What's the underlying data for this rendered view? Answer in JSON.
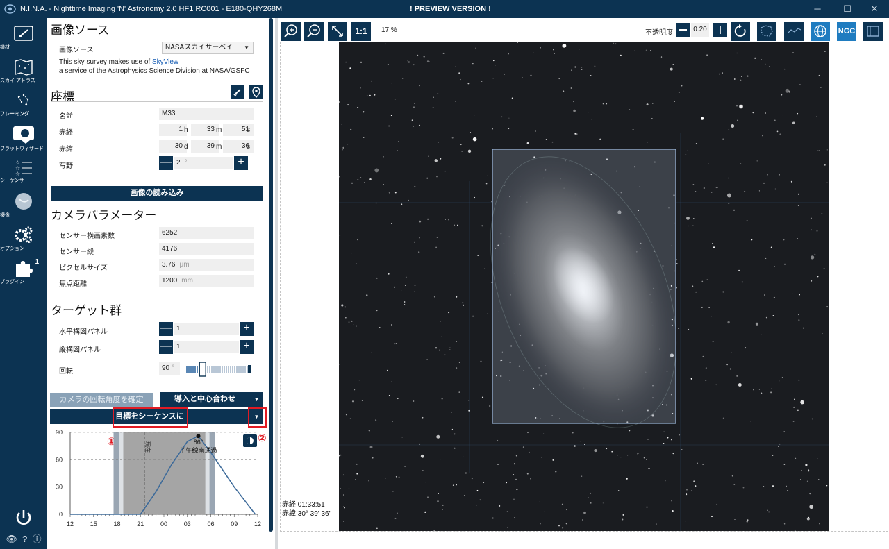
{
  "titlebar": {
    "title": "N.I.N.A. - Nighttime Imaging 'N' Astronomy 2.0 HF1 RC001  -  E180-QHY268M",
    "preview": "! PREVIEW VERSION !",
    "minimize": "─",
    "maximize": "☐",
    "close": "✕"
  },
  "nav": {
    "equipment": "機材",
    "skyatlas": "スカイ アトラス",
    "framing": "フレーミング",
    "flat": "フラットウィザード",
    "sequencer": "シーケンサー",
    "imaging": "撮像",
    "options": "オプション",
    "plugins": "プラグイン",
    "plugins_badge": "1"
  },
  "image_source": {
    "title": "画像ソース",
    "label": "画像ソース",
    "selected": "NASAスカイサーベイ",
    "note1": "This sky survey makes use of",
    "note_link": "SkyView",
    "note2": " a service of the Astrophysics Science Division at NASA/GSFC"
  },
  "coordinates": {
    "title": "座標",
    "name_label": "名前",
    "name_value": "M33",
    "ra_label": "赤経",
    "ra_h": "1",
    "ra_h_unit": "h",
    "ra_m": "33",
    "ra_m_unit": "m",
    "ra_s": "51",
    "ra_s_unit": "s",
    "dec_label": "赤緯",
    "dec_d": "30",
    "dec_d_unit": "d",
    "dec_m": "39",
    "dec_m_unit": "m",
    "dec_s": "36",
    "dec_s_unit": "s",
    "fov_label": "写野",
    "fov_value": "2",
    "fov_unit": "°",
    "minus": "—",
    "plus": "+"
  },
  "load_image_button": "画像の読み込み",
  "camera": {
    "title": "カメラパラメーター",
    "width_label": "センサー横画素数",
    "width_value": "6252",
    "height_label": "センサー縦",
    "height_value": "4176",
    "pixel_label": "ピクセルサイズ",
    "pixel_value": "3.76",
    "pixel_unit": "μm",
    "focal_label": "焦点距離",
    "focal_value": "1200",
    "focal_unit": "mm"
  },
  "targets": {
    "title": "ターゲット群",
    "h_label": "水平構図パネル",
    "h_value": "1",
    "v_label": "縦構図パネル",
    "v_value": "1",
    "rot_label": "回転",
    "rot_value": "90",
    "rot_unit": "°",
    "rot_fraction": 0.27
  },
  "buttons": {
    "confirm_rotation": "カメラの回転角度を確定",
    "slew_center": "導入と中心合わせ",
    "add_to_sequence": "目標をシーケンスに追加"
  },
  "annotations": {
    "one": "①",
    "two": "②"
  },
  "chart_data": {
    "type": "line",
    "yticks": [
      0,
      30,
      60,
      90
    ],
    "xticks": [
      "12",
      "15",
      "18",
      "21",
      "00",
      "03",
      "06",
      "09",
      "12"
    ],
    "ylim": [
      0,
      90
    ],
    "peak_label": "86°",
    "transit_label": "子午線南通過",
    "now_label": "現在",
    "series": [
      {
        "x": [
          12,
          15,
          18,
          19.5,
          21,
          23,
          1,
          3,
          4.4,
          6,
          9,
          11.7
        ],
        "values": [
          0,
          0,
          0,
          0,
          0,
          25,
          55,
          80,
          86,
          68,
          30,
          0
        ]
      }
    ],
    "night_shading": [
      "18.8",
      "5.3"
    ]
  },
  "viewer": {
    "zoom_in": "+",
    "zoom_out": "−",
    "fit": "⤢",
    "one_to_one": "1:1",
    "zoom_percent": "17 %",
    "opacity_label": "不透明度",
    "opacity_value": "0.20",
    "ngc": "NGC",
    "coord_ra": "赤経  01:33:51",
    "coord_dec": "赤緯  30° 39' 36\""
  }
}
